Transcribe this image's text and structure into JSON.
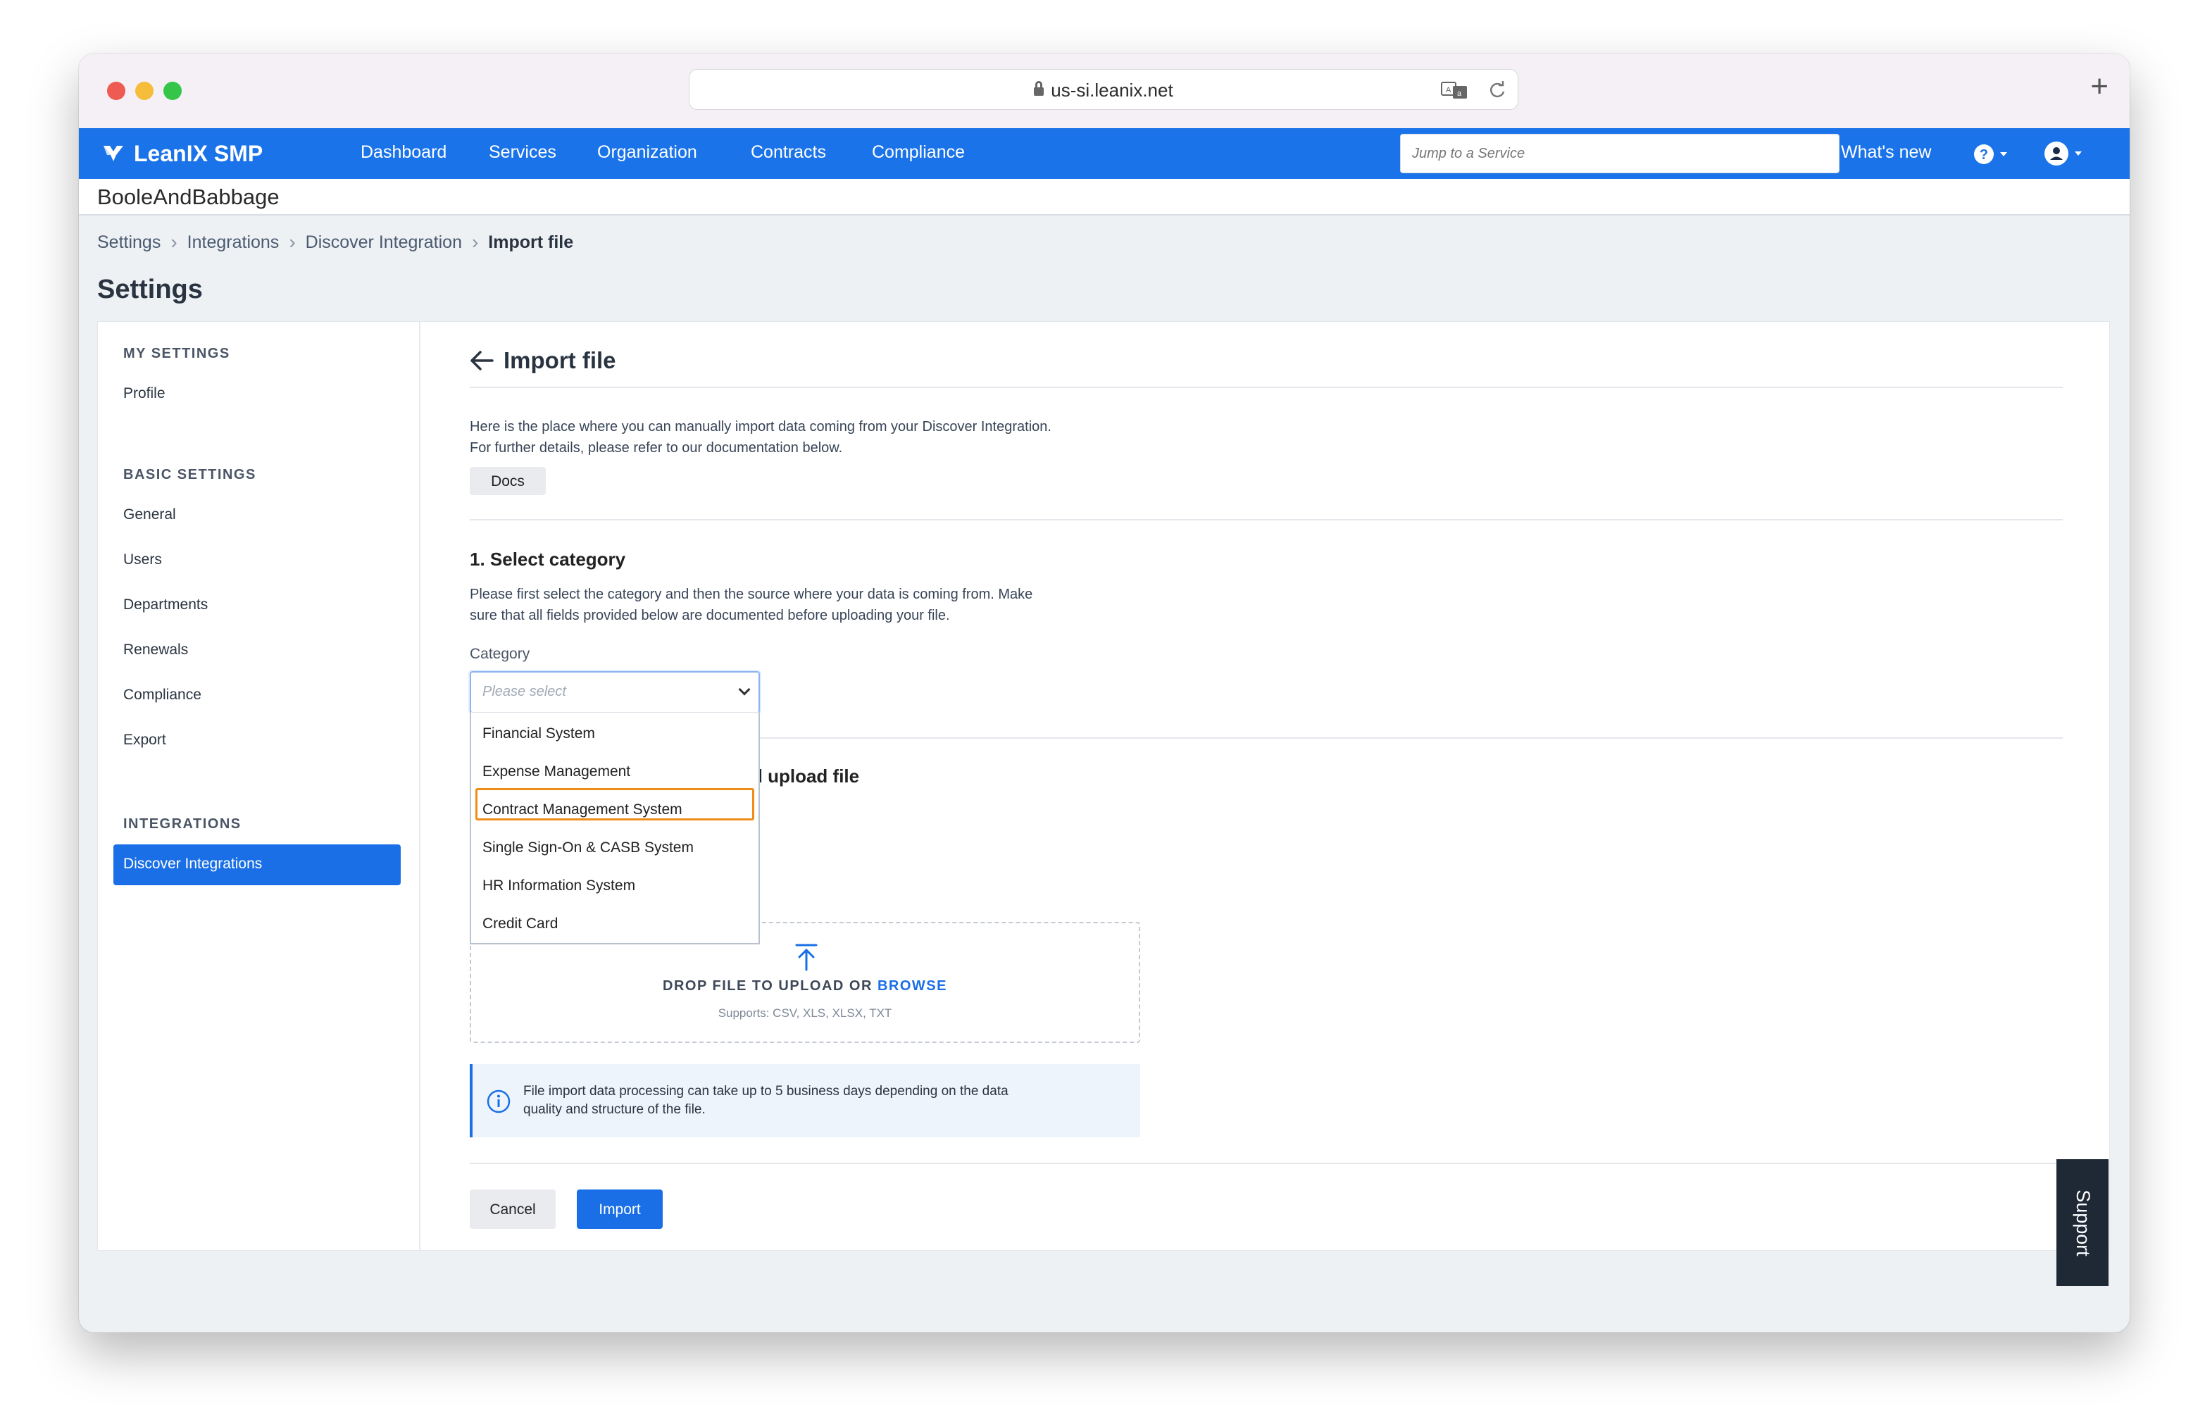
{
  "browser": {
    "url": "us-si.leanix.net",
    "new_tab_symbol": "+"
  },
  "navbar": {
    "brand": "LeanIX SMP",
    "links": [
      "Dashboard",
      "Services",
      "Organization",
      "Contracts",
      "Compliance"
    ],
    "search_placeholder": "Jump to a Service",
    "whats_new": "What's new",
    "accent_color": "#1a73e8"
  },
  "org": {
    "name": "BooleAndBabbage"
  },
  "breadcrumb": {
    "items": [
      "Settings",
      "Integrations",
      "Discover Integration",
      "Import file"
    ]
  },
  "page": {
    "title": "Settings"
  },
  "sidebar": {
    "sections": [
      {
        "title": "MY SETTINGS",
        "items": [
          "Profile"
        ]
      },
      {
        "title": "BASIC SETTINGS",
        "items": [
          "General",
          "Users",
          "Departments",
          "Renewals",
          "Compliance",
          "Export"
        ]
      },
      {
        "title": "INTEGRATIONS",
        "items": [
          "Discover Integrations"
        ]
      }
    ],
    "active_item": "Discover Integrations"
  },
  "main": {
    "heading": "Import file",
    "intro_line1": "Here is the place where you can manually import data coming from your Discover Integration.",
    "intro_line2": "For further details, please refer to our documentation below.",
    "docs_label": "Docs",
    "step1_title": "1. Select category",
    "step1_desc_line1": "Please first select the category and then the source where your data is coming from. Make",
    "step1_desc_line2": "sure that all fields provided below are documented before uploading your file.",
    "category_label": "Category",
    "category_placeholder": "Please select",
    "category_options": [
      "Financial System",
      "Expense Management",
      "Contract Management System",
      "Single Sign-On & CASB System",
      "HR Information System",
      "Credit Card"
    ],
    "highlighted_option": "Contract Management System",
    "step2_title_partial": "d upload file",
    "upload_text": "DROP FILE TO UPLOAD OR",
    "upload_browse": "BROWSE",
    "upload_supports": "Supports: CSV, XLS, XLSX, TXT",
    "info_line1": "File import data processing can take up to 5 business days depending on the data",
    "info_line2": "quality and structure of the file.",
    "cancel_label": "Cancel",
    "import_label": "Import"
  },
  "support_label": "Support"
}
